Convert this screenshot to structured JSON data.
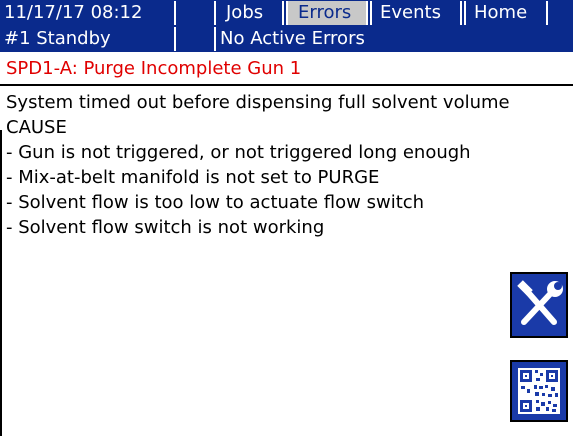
{
  "header": {
    "datetime": "11/17/17 08:12",
    "tabs": [
      {
        "label": "Jobs",
        "active": false
      },
      {
        "label": "Errors",
        "active": true
      },
      {
        "label": "Events",
        "active": false
      },
      {
        "label": "Home",
        "active": false
      }
    ]
  },
  "status": {
    "unit": "#1 Standby",
    "message": "No Active Errors"
  },
  "error": {
    "title": "SPD1-A: Purge Incomplete Gun 1",
    "lines": [
      "System timed out before dispensing full solvent volume",
      "CAUSE",
      "- Gun is not triggered, or not triggered long enough",
      "- Mix-at-belt manifold is not set to PURGE",
      "- Solvent flow is too low to actuate flow switch",
      "- Solvent flow switch is not working"
    ]
  },
  "colors": {
    "bar": "#0a2a8c",
    "error_text": "#e00000",
    "active_tab": "#c8c8c8"
  },
  "icons": [
    "tools-icon",
    "qr-code-icon"
  ]
}
